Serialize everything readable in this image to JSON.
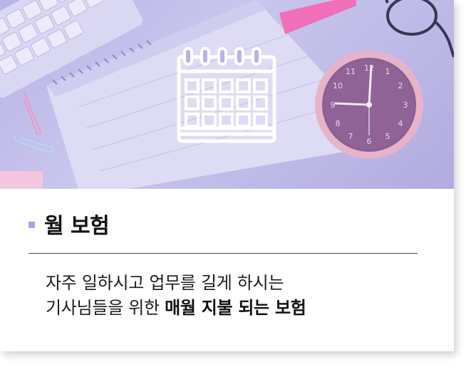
{
  "card": {
    "title": "월 보험",
    "description_line1": "자주 일하시고 업무를 길게 하시는",
    "description_line2_normal": "기사님들을 위한 ",
    "description_line2_bold": "매월 지불 되는 보험"
  },
  "hero": {
    "icon": "calendar-icon",
    "clock_numbers": [
      "12",
      "1",
      "2",
      "3",
      "4",
      "5",
      "6",
      "7",
      "8",
      "9",
      "10",
      "11"
    ]
  },
  "colors": {
    "accent": "#a8a3e8",
    "overlay": "#b7b3e6"
  }
}
